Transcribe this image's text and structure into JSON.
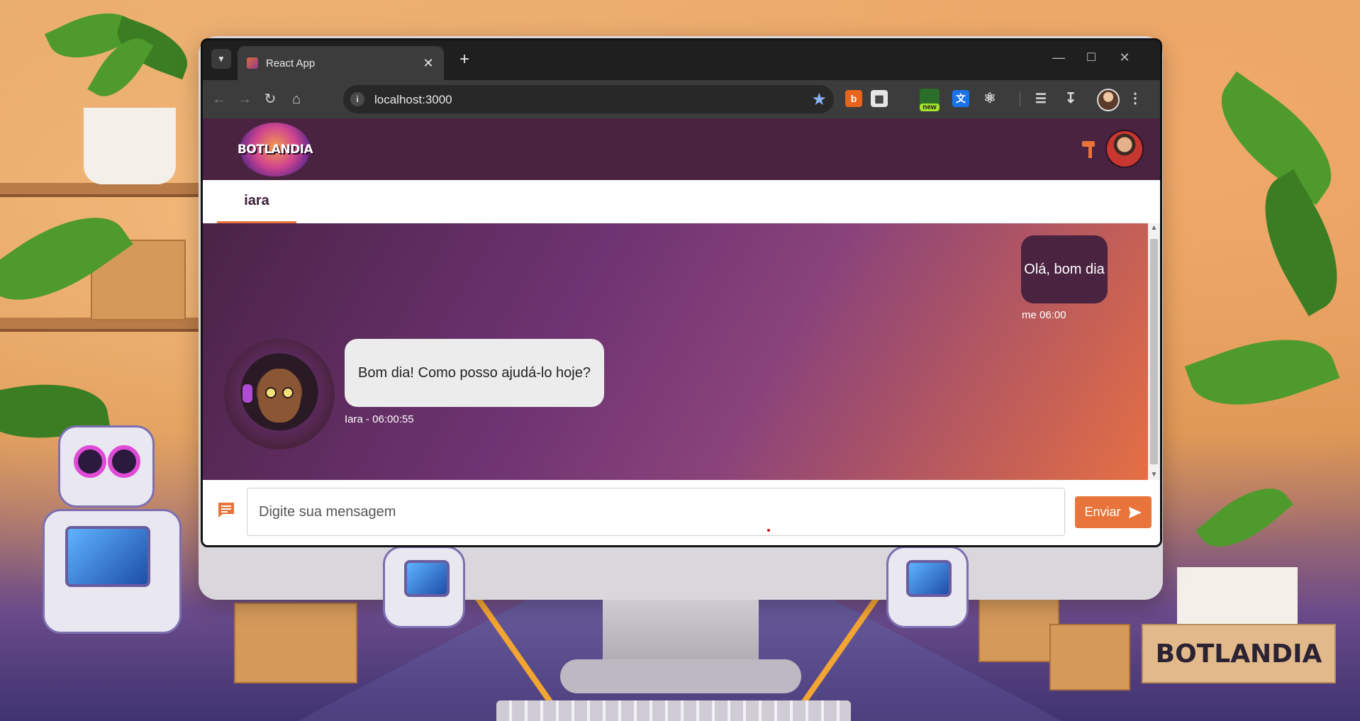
{
  "browser": {
    "tab_title": "React App",
    "url": "localhost:3000",
    "new_ext_badge": "new"
  },
  "app": {
    "logo_text": "BOTLANDIA",
    "active_bot_tab": "iara"
  },
  "chat": {
    "messages": [
      {
        "from": "user",
        "text": "Olá, bom dia",
        "meta": "me 06:00"
      },
      {
        "from": "bot",
        "text": "Bom dia! Como posso ajudá-lo hoje?",
        "meta": "Iara - 06:00:55"
      }
    ]
  },
  "composer": {
    "placeholder": "Digite sua mensagem",
    "send_label": "Enviar"
  },
  "scene": {
    "sign_text": "BOTLANDIA"
  },
  "colors": {
    "appbar": "#4a2340",
    "accent": "#e8743b",
    "user_bubble": "#4a2340",
    "bot_bubble": "#ececec"
  }
}
